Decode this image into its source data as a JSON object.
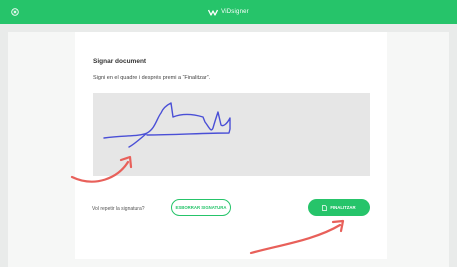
{
  "header": {
    "brand": "ViDsigner",
    "brand_color": "#26c46a"
  },
  "icons": {
    "close": "close-circle-icon",
    "logo": "vidsigner-logo-icon",
    "finish": "document-icon"
  },
  "card": {
    "title": "Signar document",
    "instructions": "Signi en el quadre i després premi a “Finalitzar”."
  },
  "signature_pad": {
    "background": "#e6e6e6",
    "ink_color": "#4a4fd6"
  },
  "footer": {
    "redo_label": "Vol repetir la signatura?",
    "clear_button": "ESBORRAR SIGNATURA",
    "finish_button": "FINALITZAR"
  },
  "annotations": {
    "arrow_color": "#e8605a"
  }
}
